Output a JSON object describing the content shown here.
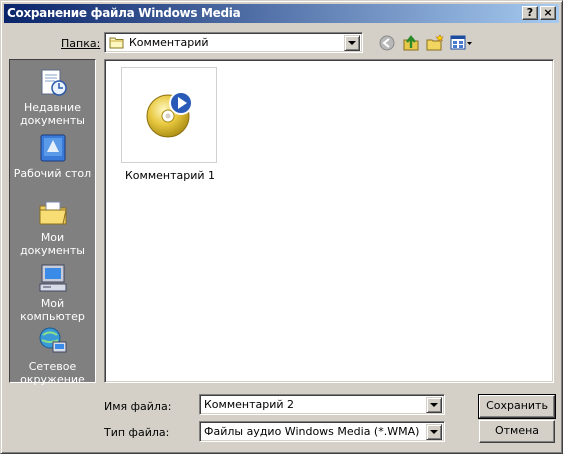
{
  "window": {
    "title": "Сохранение файла Windows Media",
    "help_button": "?",
    "close_button": "×"
  },
  "lookin": {
    "label": "Папка:",
    "value": "Комментарий",
    "tool_icons": [
      "back-arrow-icon",
      "up-folder-icon",
      "new-folder-icon",
      "view-menu-icon"
    ]
  },
  "places": [
    {
      "label_line1": "Недавние",
      "label_line2": "документы",
      "icon": "recent-documents-icon"
    },
    {
      "label_line1": "Рабочий стол",
      "label_line2": "",
      "icon": "desktop-icon"
    },
    {
      "label_line1": "Мои",
      "label_line2": "документы",
      "icon": "my-documents-icon"
    },
    {
      "label_line1": "Мой",
      "label_line2": "компьютер",
      "icon": "my-computer-icon"
    },
    {
      "label_line1": "Сетевое",
      "label_line2": "окружение",
      "icon": "network-places-icon"
    }
  ],
  "files": [
    {
      "name": "Комментарий 1",
      "icon": "media-disc-icon"
    }
  ],
  "filename": {
    "label": "Имя файла:",
    "value": "Комментарий 2"
  },
  "filetype": {
    "label": "Тип файла:",
    "value": "Файлы аудио Windows Media (*.WMA)"
  },
  "buttons": {
    "save": "Сохранить",
    "cancel": "Отмена"
  },
  "colors": {
    "title_start": "#0a246a",
    "title_end": "#a6caf0",
    "dialog_face": "#d4d0c8",
    "places_bar": "#808080"
  }
}
